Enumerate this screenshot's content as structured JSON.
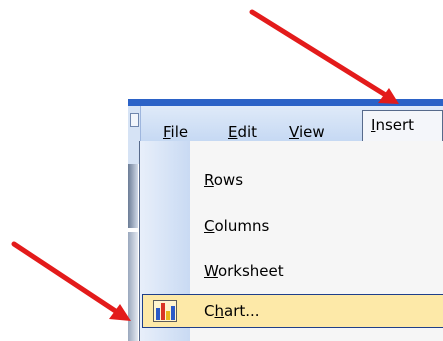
{
  "menubar": {
    "items": [
      {
        "label": "File",
        "accel": "F",
        "rest": "ile"
      },
      {
        "label": "Edit",
        "accel": "E",
        "rest": "dit"
      },
      {
        "label": "View",
        "accel": "V",
        "rest": "iew"
      },
      {
        "label": "Insert",
        "accel": "I",
        "rest": "nsert"
      }
    ]
  },
  "dropdown": {
    "items": [
      {
        "label": "Rows",
        "accel": "R",
        "rest": "ows"
      },
      {
        "label": "Columns",
        "accel": "C",
        "rest": "olumns"
      },
      {
        "label": "Worksheet",
        "accel": "W",
        "rest": "orksheet"
      },
      {
        "label": "Chart...",
        "pre": "C",
        "accel": "h",
        "rest": "art..."
      }
    ],
    "highlighted": "Chart..."
  },
  "colors": {
    "arrow": "#e31b1b",
    "menubar_border": "#2b62c7",
    "highlight_fill": "#fde9a8",
    "highlight_border": "#1f3f8a"
  },
  "icons": [
    "chart-icon"
  ]
}
